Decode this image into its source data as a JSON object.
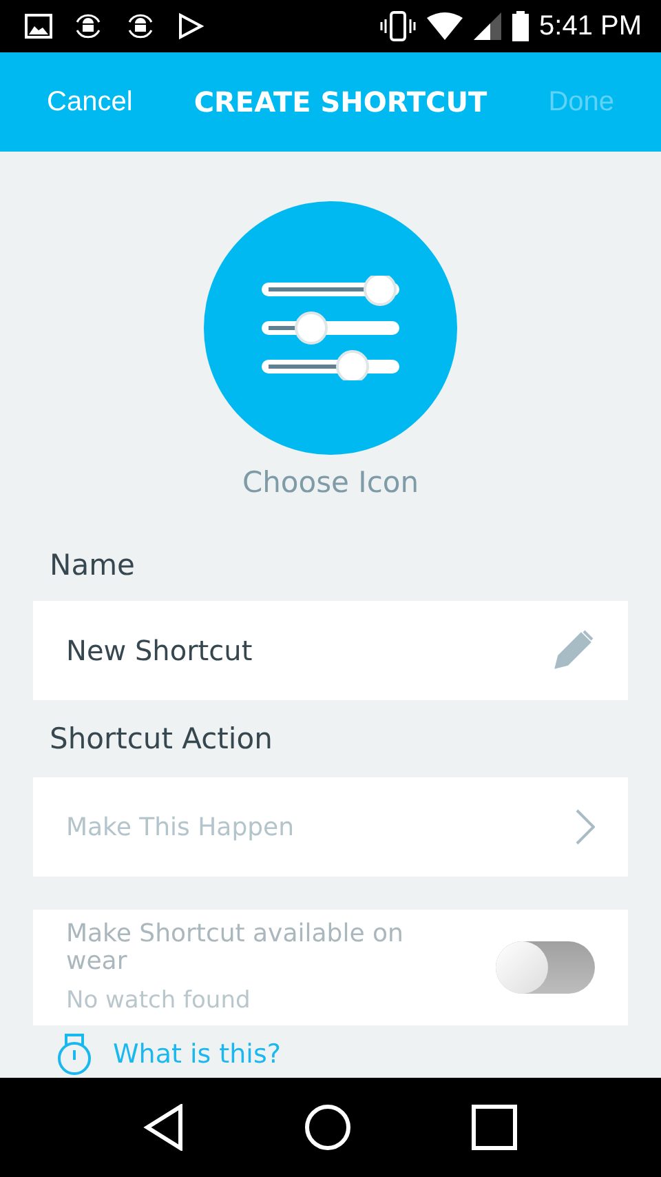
{
  "status_bar": {
    "time": "5:41 PM"
  },
  "app_bar": {
    "cancel": "Cancel",
    "title": "CREATE SHORTCUT",
    "done": {
      "label": "Done",
      "disabled": true
    }
  },
  "icon_picker": {
    "label": "Choose Icon"
  },
  "name_section": {
    "heading": "Name",
    "value": "New Shortcut"
  },
  "action_section": {
    "heading": "Shortcut Action",
    "placeholder": "Make This Happen"
  },
  "wear": {
    "label": "Make Shortcut available on wear",
    "note": "No watch found",
    "on": false,
    "disabled": true
  },
  "help_link": "What is this?"
}
